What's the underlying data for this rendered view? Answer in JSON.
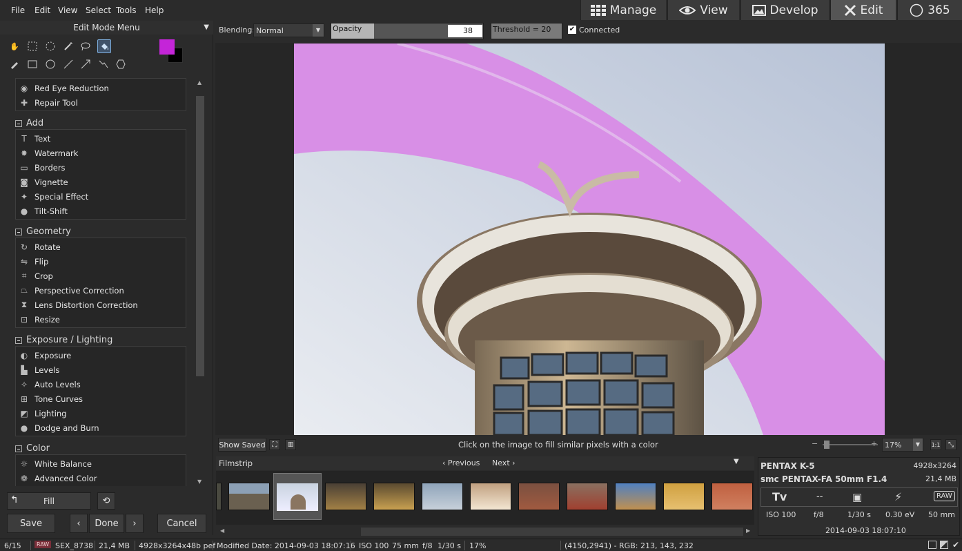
{
  "menu": {
    "file": "File",
    "edit": "Edit",
    "view": "View",
    "select": "Select",
    "tools": "Tools",
    "help": "Help"
  },
  "modes": {
    "manage": "Manage",
    "view": "View",
    "develop": "Develop",
    "edit": "Edit",
    "n365": "365"
  },
  "left": {
    "title": "Edit Mode Menu",
    "groups": [
      {
        "items": [
          "Red Eye Reduction",
          "Repair Tool"
        ]
      },
      {
        "name": "Add",
        "items": [
          "Text",
          "Watermark",
          "Borders",
          "Vignette",
          "Special Effect",
          "Tilt-Shift"
        ]
      },
      {
        "name": "Geometry",
        "items": [
          "Rotate",
          "Flip",
          "Crop",
          "Perspective Correction",
          "Lens Distortion Correction",
          "Resize"
        ]
      },
      {
        "name": "Exposure / Lighting",
        "items": [
          "Exposure",
          "Levels",
          "Auto Levels",
          "Tone Curves",
          "Lighting",
          "Dodge and Burn"
        ]
      },
      {
        "name": "Color",
        "items": [
          "White Balance",
          "Advanced Color"
        ]
      }
    ],
    "fill": "Fill",
    "save": "Save",
    "done": "Done",
    "cancel": "Cancel"
  },
  "toolbar": {
    "blending_label": "Blending:",
    "blending_value": "Normal",
    "opacity_label": "Opacity",
    "opacity_value": "38",
    "threshold": "Threshold = 20",
    "connected": "Connected"
  },
  "under": {
    "show_saved": "Show Saved",
    "hint": "Click on the image to fill similar pixels with a color",
    "zoom": "17%",
    "one_to_one": "1:1"
  },
  "filmstrip": {
    "label": "Filmstrip",
    "previous": "Previous",
    "next": "Next"
  },
  "info": {
    "camera": "PENTAX K-5",
    "dimensions": "4928x3264",
    "lens": "smc PENTAX-FA 50mm F1.4",
    "size": "21,4 MB",
    "mode": "Tv",
    "dash": "--",
    "raw": "RAW",
    "iso": "ISO 100",
    "fstop": "f/8",
    "shutter": "1/30 s",
    "ev": "0.30 eV",
    "focal": "50 mm",
    "date": "2014-09-03 18:07:10"
  },
  "status": {
    "count": "6/15",
    "raw": "RAW",
    "file": "SEX_8738",
    "size": "21,4 MB",
    "dims": "4928x3264x48b pef",
    "modified": "Modified Date: 2014-09-03 18:07:16",
    "iso": "ISO 100",
    "focal": "75 mm",
    "fstop": "f/8",
    "shutter": "1/30 s",
    "zoom": "17%",
    "pixel": "(4150,2941) - RGB: 213, 143, 232"
  },
  "colors": {
    "fg": "#c425d8",
    "bg": "#000000",
    "fill_tint": "#d88fe6"
  }
}
